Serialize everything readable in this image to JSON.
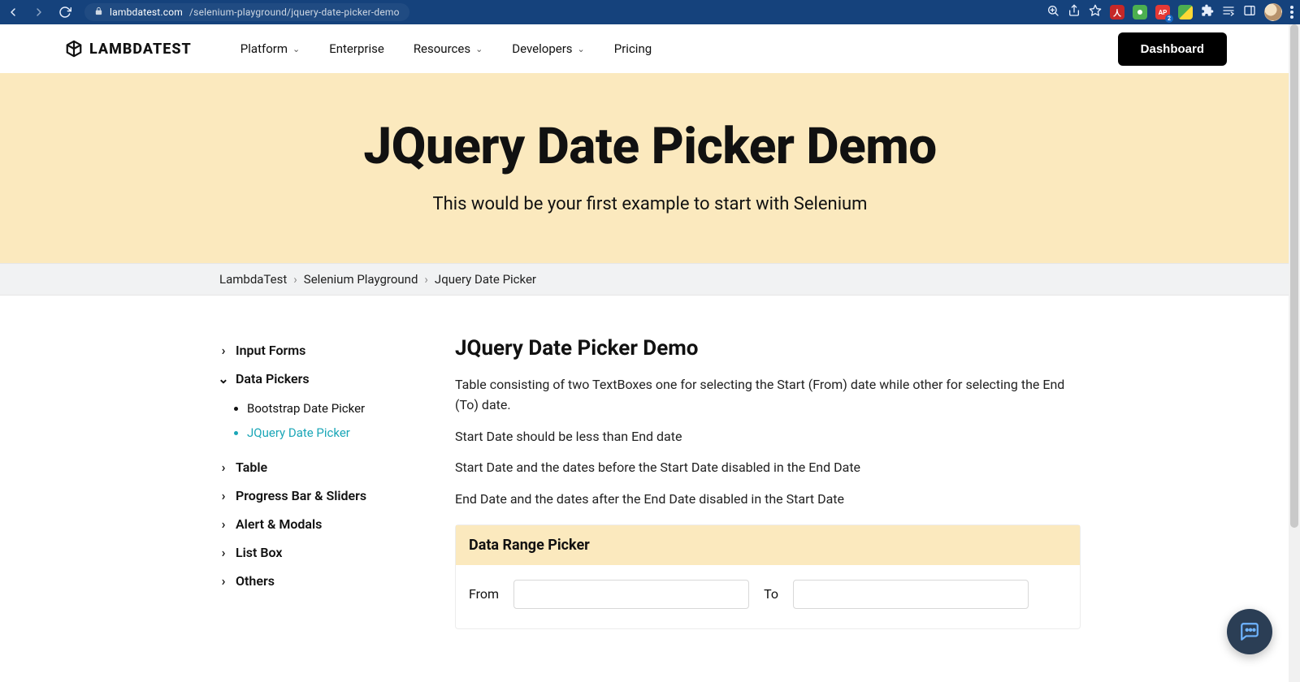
{
  "browser": {
    "url_host": "lambdatest.com",
    "url_path": "/selenium-playground/jquery-date-picker-demo"
  },
  "nav": {
    "brand": "LAMBDATEST",
    "items": [
      "Platform",
      "Enterprise",
      "Resources",
      "Developers",
      "Pricing"
    ],
    "has_dropdown": [
      true,
      false,
      true,
      true,
      false
    ],
    "dashboard_label": "Dashboard"
  },
  "hero": {
    "title": "JQuery Date Picker Demo",
    "subtitle": "This would be your first example to start with Selenium"
  },
  "breadcrumb": {
    "items": [
      "LambdaTest",
      "Selenium Playground",
      "Jquery Date Picker"
    ]
  },
  "sidebar": {
    "groups": [
      {
        "label": "Input Forms",
        "expanded": false
      },
      {
        "label": "Data Pickers",
        "expanded": true,
        "children": [
          {
            "label": "Bootstrap Date Picker",
            "active": false
          },
          {
            "label": "JQuery Date Picker",
            "active": true
          }
        ]
      },
      {
        "label": "Table",
        "expanded": false
      },
      {
        "label": "Progress Bar & Sliders",
        "expanded": false
      },
      {
        "label": "Alert & Modals",
        "expanded": false
      },
      {
        "label": "List Box",
        "expanded": false
      },
      {
        "label": "Others",
        "expanded": false
      }
    ]
  },
  "content": {
    "heading": "JQuery Date Picker Demo",
    "paragraphs": [
      "Table consisting of two TextBoxes one for selecting the Start (From) date while other for selecting the End (To) date.",
      "Start Date should be less than End date",
      "Start Date and the dates before the Start Date disabled in the End Date",
      "End Date and the dates after the End Date disabled in the Start Date"
    ],
    "panel": {
      "title": "Data Range Picker",
      "from_label": "From",
      "to_label": "To",
      "from_value": "",
      "to_value": ""
    }
  },
  "colors": {
    "accent_cream": "#fbe9be",
    "browser_blue": "#15427c",
    "link_teal": "#1aa6b7"
  }
}
